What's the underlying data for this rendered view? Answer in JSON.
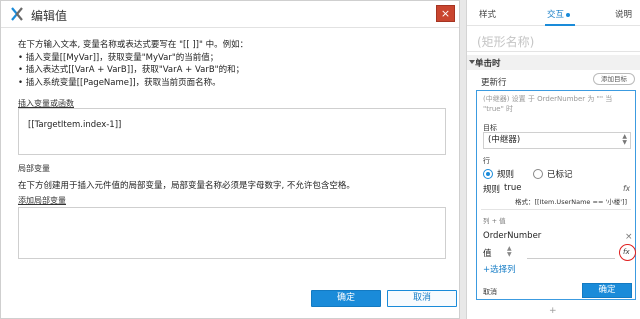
{
  "dialog": {
    "title": "编辑值",
    "close_label": "×",
    "instructions": [
      "在下方输入文本, 变量名称或表达式要写在 \"[[ ]]\" 中。例如：",
      "• 插入变量[[MyVar]]，获取变量\"MyVar\"的当前值；",
      "• 插入表达式[[VarA + VarB]]，获取\"VarA + VarB\"的和；",
      "• 插入系统变量[[PageName]]，获取当前页面名称。"
    ],
    "insert_link": "插入变量或函数",
    "expression": "[[TargetItem.index-1]]",
    "local_vars_label": "局部变量",
    "local_vars_desc": "在下方创建用于插入元件值的局部变量，局部变量名称必须是字母数字, 不允许包含空格。",
    "add_local_var": "添加局部变量",
    "ok_label": "确定",
    "cancel_label": "取消"
  },
  "panel": {
    "tabs": [
      {
        "label": "样式"
      },
      {
        "label": "交互"
      },
      {
        "label": "说明"
      }
    ],
    "shape_name_placeholder": "(矩形名称)",
    "event_name": "单击时",
    "case_label": "更新行",
    "add_target_label": "添加目标",
    "action": {
      "description": "(中继器) 设置 于 OrderNumber 为 \"\" 当 \"true\" 时",
      "target_label": "目标",
      "target_value": "(中继器)",
      "row_label": "行",
      "radio_rule": "规则",
      "radio_marked": "已标记",
      "rule_label": "规则",
      "rule_value": "true",
      "format_hint": "格式：[[Item.UserName == '小楼']]",
      "col_value_label": "列 + 值",
      "column_name": "OrderNumber",
      "value_label": "值",
      "add_column": "+选择列",
      "cancel": "取消",
      "confirm": "确定",
      "fx_label": "fx"
    },
    "bottom_plus": "+"
  },
  "colors": {
    "accent": "#1a8bd9",
    "close_red": "#c9452f",
    "highlight_circle": "#e02020"
  }
}
